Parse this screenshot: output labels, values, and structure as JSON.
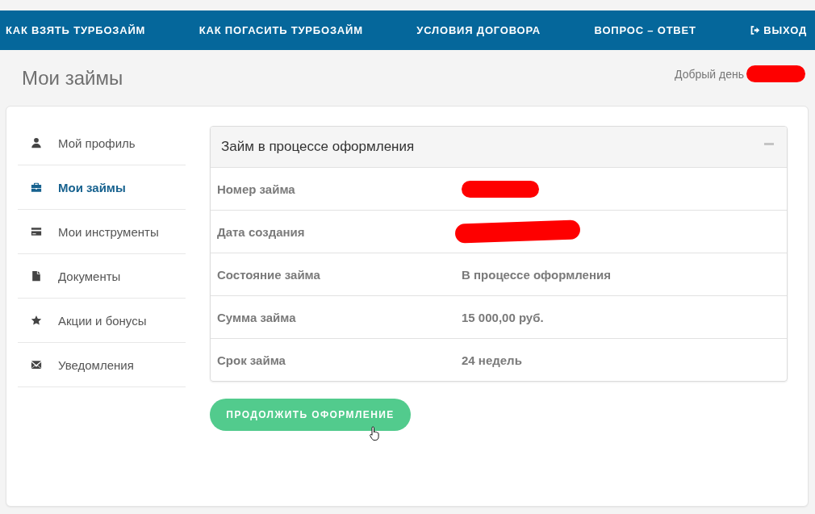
{
  "top_nav": {
    "items": [
      {
        "label": "КАК ВЗЯТЬ ТУРБОЗАЙМ",
        "kind": "link"
      },
      {
        "label": "КАК ПОГАСИТЬ ТУРБОЗАЙМ",
        "kind": "link"
      },
      {
        "label": "УСЛОВИЯ ДОГОВОРА",
        "kind": "link"
      },
      {
        "label": "ВОПРОС – ОТВЕТ",
        "kind": "link"
      },
      {
        "label": "ВЫХОД",
        "kind": "logout"
      }
    ]
  },
  "header": {
    "title": "Мои займы",
    "greeting": "Добрый день",
    "greeting_redacted": true
  },
  "sidebar": {
    "items": [
      {
        "label": "Мой профиль",
        "selected": false
      },
      {
        "label": "Мои займы",
        "selected": true
      },
      {
        "label": "Мои инструменты",
        "selected": false
      },
      {
        "label": "Документы",
        "selected": false
      },
      {
        "label": "Акции и бонусы",
        "selected": false
      },
      {
        "label": "Уведомления",
        "selected": false
      }
    ]
  },
  "loan_panel": {
    "title": "Займ в процессе оформления",
    "expanded": true,
    "rows": [
      {
        "label": "Номер займа",
        "redacted": true
      },
      {
        "label": "Дата создания",
        "redacted": true
      },
      {
        "label": "Состояние займа",
        "value": "В процессе оформления",
        "redacted": false
      },
      {
        "label": "Сумма займа",
        "value": "15 000,00 руб.",
        "redacted": false
      },
      {
        "label": "Срок займа",
        "value": "24 недель",
        "redacted": false
      }
    ]
  },
  "continue_button": {
    "label": "ПРОДОЛЖИТЬ ОФОРМЛЕНИЕ"
  }
}
